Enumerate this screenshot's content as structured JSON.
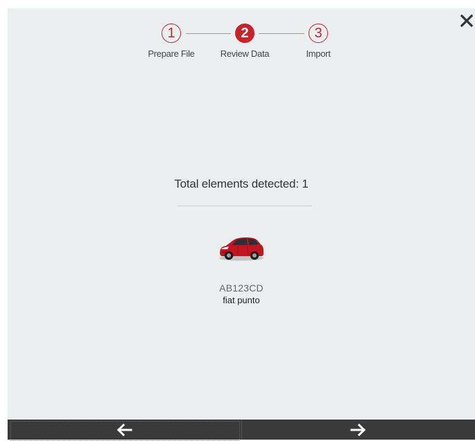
{
  "steps": [
    {
      "number": "1",
      "label": "Prepare File",
      "state": "done"
    },
    {
      "number": "2",
      "label": "Review Data",
      "state": "current"
    },
    {
      "number": "3",
      "label": "Import",
      "state": "upcoming"
    }
  ],
  "summary": {
    "text": "Total elements detected: 1"
  },
  "vehicle": {
    "icon": "car-icon",
    "plate": "AB123CD",
    "model": "fiat punto"
  },
  "colors": {
    "accent": "#c8222a",
    "background": "#eceff0",
    "footer": "#3a3a3a"
  },
  "footer": {
    "back_icon": "arrow-left-icon",
    "next_icon": "arrow-right-icon"
  },
  "close_icon": "close-icon"
}
